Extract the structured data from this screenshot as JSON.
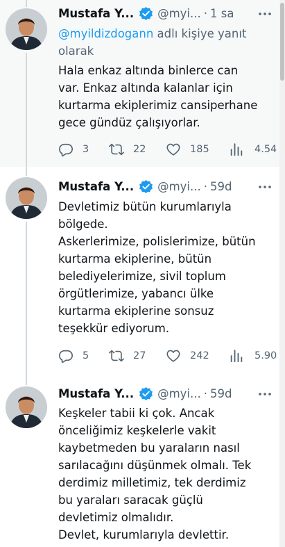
{
  "colors": {
    "accent": "#1d9bf0",
    "secondary_text": "#536471",
    "primary_text": "#0f1419",
    "highlight_bg": "#f7f9f9",
    "thread_line": "#cfd9de"
  },
  "tweets": [
    {
      "name": "Mustafa Y...",
      "handle": "@myi...",
      "separator": "·",
      "time": "1 sa",
      "reply_to": {
        "mention": "@myildizdogann",
        "suffix": " adlı kişiye yanıt olarak"
      },
      "text_lines": [
        "Hala enkaz altında binlerce can",
        "var. Enkaz altında kalanlar için",
        "kurtarma ekiplerimiz cansiperhane",
        "gece gündüz çalışıyorlar."
      ],
      "stats": {
        "replies": "3",
        "retweets": "22",
        "likes": "185",
        "views": "4.54"
      }
    },
    {
      "name": "Mustafa Y...",
      "handle": "@myi...",
      "separator": "·",
      "time": "59d",
      "text_lines": [
        "Devletimiz bütün kurumlarıyla",
        "bölgede.",
        "Askerlerimize, polislerimize, bütün",
        "kurtarma ekiplerine, bütün",
        "belediyelerimize, sivil toplum",
        "örgütlerimize, yabancı ülke",
        "kurtarma ekiplerine sonsuz",
        "teşekkür ediyorum."
      ],
      "stats": {
        "replies": "5",
        "retweets": "27",
        "likes": "242",
        "views": "5.90"
      }
    },
    {
      "name": "Mustafa Y...",
      "handle": "@myi...",
      "separator": "·",
      "time": "59d",
      "text_lines": [
        "Keşkeler tabii ki çok. Ancak",
        "önceliğimiz keşkelerle vakit",
        "kaybetmeden bu yaraların nasıl",
        "sarılacağını düşünmek olmalı. Tek",
        "derdimiz milletimiz, tek derdimiz",
        "bu yaraları saracak güçlü",
        "devletimiz olmalıdır.",
        "Devlet, kurumlarıyla devlettir."
      ]
    }
  ],
  "icons": {
    "verified": "verified-badge-icon",
    "more": "more-dots-icon",
    "reply": "reply-icon",
    "retweet": "retweet-icon",
    "like": "heart-icon",
    "views": "views-icon"
  }
}
